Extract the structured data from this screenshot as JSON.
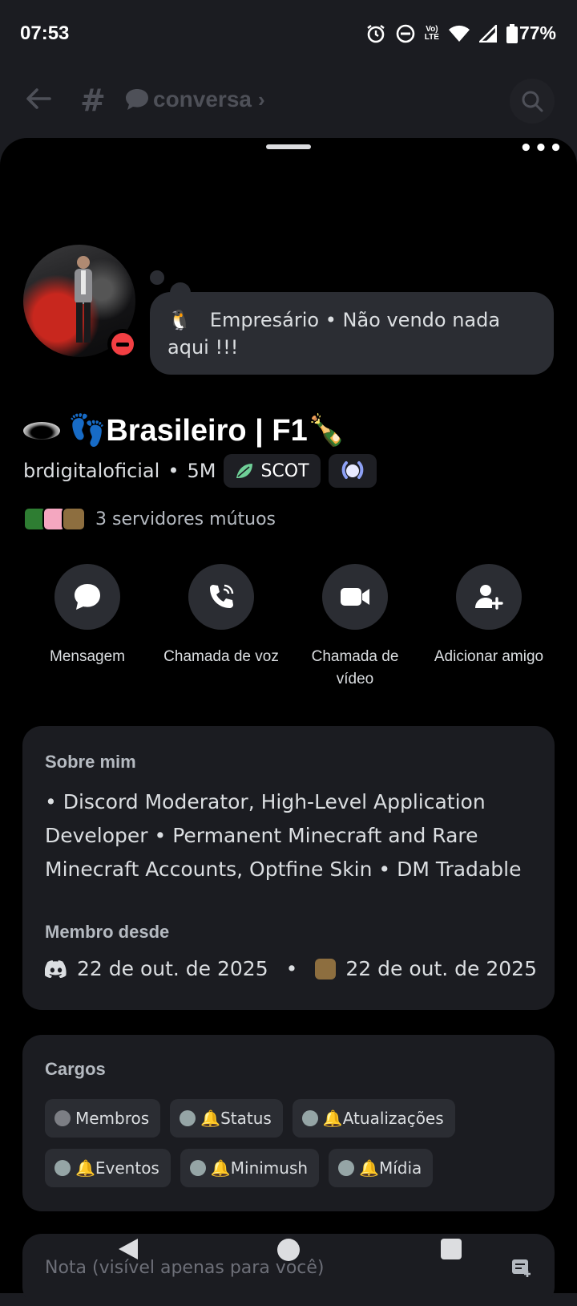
{
  "status_bar": {
    "time": "07:53",
    "battery": "77%",
    "icons": [
      "alarm-icon",
      "dnd-status-icon",
      "volte-icon",
      "wifi-icon",
      "signal-icon",
      "battery-icon"
    ],
    "volte_label": "Vo\nLTE"
  },
  "channel_header": {
    "channel_name": "conversa"
  },
  "profile": {
    "bubble_emoji": "🐧",
    "custom_status": "Empresário • Não vendo nada aqui !!!",
    "display_name": "👣Brasileiro | F1🍾",
    "username": "brdigitaloficial",
    "separator": "•",
    "tag_extra": "5M",
    "clan_tag": "SCOT",
    "mutual_servers": "3 servidores mútuos"
  },
  "actions": [
    {
      "label": "Mensagem",
      "icon": "message-icon"
    },
    {
      "label": "Chamada de voz",
      "icon": "phone-icon"
    },
    {
      "label": "Chamada de vídeo",
      "icon": "video-icon"
    },
    {
      "label": "Adicionar amigo",
      "icon": "add-friend-icon"
    }
  ],
  "about": {
    "heading": "Sobre mim",
    "text": "• Discord Moderator, High-Level Application Developer • Permanent Minecraft and Rare Minecraft Accounts, Optfine Skin • DM Tradable",
    "member_since_heading": "Membro desde",
    "discord_date": "22 de out. de 2025",
    "dot": "•",
    "server_date": "22 de out. de 2025"
  },
  "roles": {
    "heading": "Cargos",
    "items": [
      {
        "label": "Membros",
        "color": "#7c7e84"
      },
      {
        "label": "🔔Status",
        "color": "#95a5a6"
      },
      {
        "label": "🔔Atualizações",
        "color": "#95a5a6"
      },
      {
        "label": "🔔Eventos",
        "color": "#95a5a6"
      },
      {
        "label": "🔔Minimush",
        "color": "#95a5a6"
      },
      {
        "label": "🔔Mídia",
        "color": "#95a5a6"
      }
    ]
  },
  "note": {
    "placeholder": "Nota (visível apenas para você)"
  },
  "colors": {
    "dnd": "#f23f43",
    "sheet_bg": "#000000",
    "card_bg": "#1b1c21",
    "chip_bg": "#2b2d33"
  }
}
